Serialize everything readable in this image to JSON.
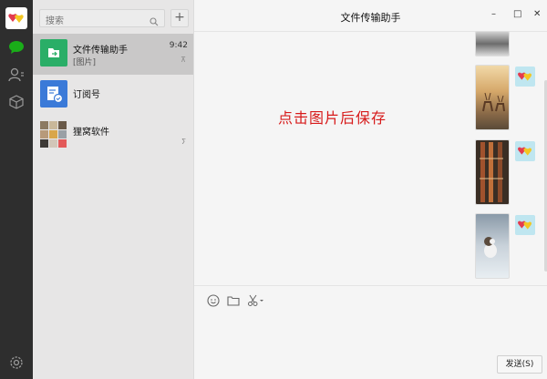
{
  "window": {
    "title": "文件传输助手"
  },
  "search": {
    "placeholder": "搜索"
  },
  "conversations": [
    {
      "name": "文件传输助手",
      "preview": "[图片]",
      "time": "9:42",
      "pin": "⊼"
    },
    {
      "name": "订阅号",
      "preview": "",
      "time": "",
      "pin": ""
    },
    {
      "name": "狸窝软件",
      "preview": "",
      "time": "",
      "pin": "ⵢ"
    }
  ],
  "chat": {
    "annotation": "点击图片后保存",
    "send_label": "发送(S)"
  },
  "colors": {
    "nav_bg": "#2e2e2e",
    "list_bg": "#e7e6e6",
    "accent_green": "#1aad19",
    "annotation": "#d71a1a"
  }
}
